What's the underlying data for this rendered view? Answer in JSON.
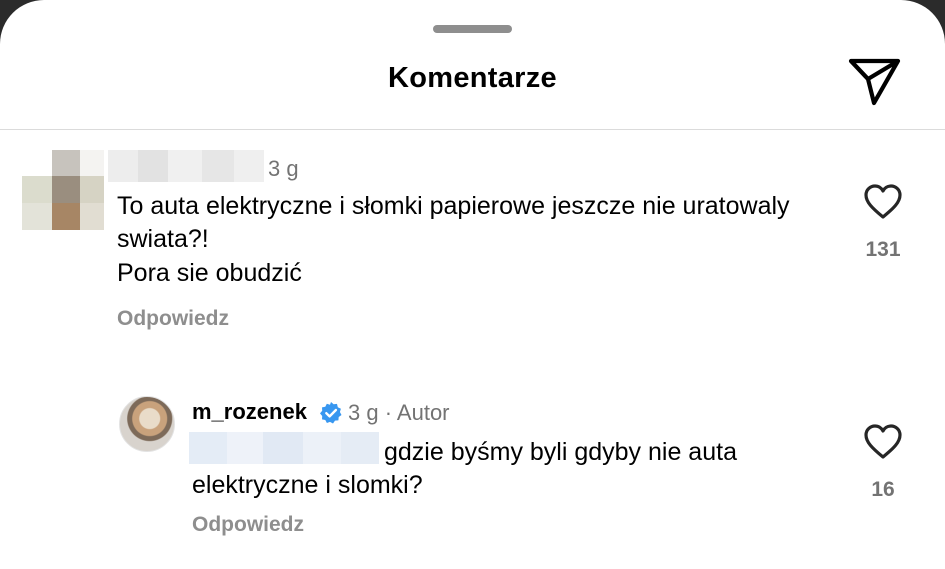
{
  "header": {
    "title": "Komentarze",
    "share_icon": "send-icon"
  },
  "comments": [
    {
      "username_obscured": true,
      "time": "3 g",
      "text_line1": "To auta elektryczne i słomki papierowe jeszcze nie uratowaly swiata?!",
      "text_line2": "Pora sie obudzić",
      "reply_label": "Odpowiedz",
      "like_icon": "heart-icon",
      "likes": "131"
    },
    {
      "username": "m_rozenek",
      "verified": true,
      "meta": "3 g · Autor",
      "mention_obscured": true,
      "text": "gdzie byśmy byli gdyby nie auta elektryczne i slomki?",
      "reply_label": "Odpowiedz",
      "like_icon": "heart-icon",
      "likes": "16"
    }
  ],
  "colors": {
    "background": "#ffffff",
    "secondary_text": "#737373",
    "verified_blue": "#3897f0",
    "divider": "#dbdbdb"
  }
}
